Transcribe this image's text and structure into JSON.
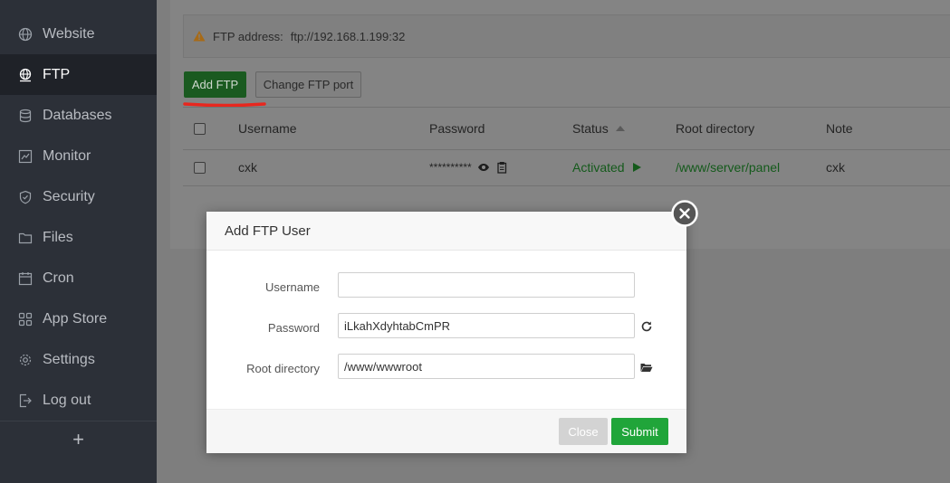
{
  "sidebar": {
    "items": [
      {
        "label": "Website",
        "icon": "globe-icon"
      },
      {
        "label": "FTP",
        "icon": "ftp-globe-icon",
        "active": true
      },
      {
        "label": "Databases",
        "icon": "database-icon"
      },
      {
        "label": "Monitor",
        "icon": "monitor-icon"
      },
      {
        "label": "Security",
        "icon": "shield-icon"
      },
      {
        "label": "Files",
        "icon": "folder-icon"
      },
      {
        "label": "Cron",
        "icon": "calendar-icon"
      },
      {
        "label": "App Store",
        "icon": "grid-icon"
      },
      {
        "label": "Settings",
        "icon": "gear-icon"
      },
      {
        "label": "Log out",
        "icon": "logout-icon"
      }
    ],
    "add_label": "+"
  },
  "notice": {
    "label": "FTP address:",
    "value": "ftp://192.168.1.199:32"
  },
  "toolbar": {
    "add_label": "Add FTP",
    "port_label": "Change FTP port"
  },
  "table": {
    "headers": {
      "username": "Username",
      "password": "Password",
      "status": "Status",
      "root": "Root directory",
      "note": "Note"
    },
    "rows": [
      {
        "username": "cxk",
        "password": "**********",
        "status": "Activated",
        "root": "/www/server/panel",
        "note": "cxk"
      }
    ]
  },
  "modal": {
    "title": "Add FTP User",
    "fields": {
      "username_label": "Username",
      "username_value": "",
      "password_label": "Password",
      "password_value": "iLkahXdyhtabCmPR",
      "root_label": "Root directory",
      "root_value": "/www/wwwroot"
    },
    "close_label": "Close",
    "submit_label": "Submit"
  },
  "colors": {
    "sidebar_bg": "#2c3038",
    "accent_green": "#20a53a",
    "annotation_red": "#e8271e"
  }
}
